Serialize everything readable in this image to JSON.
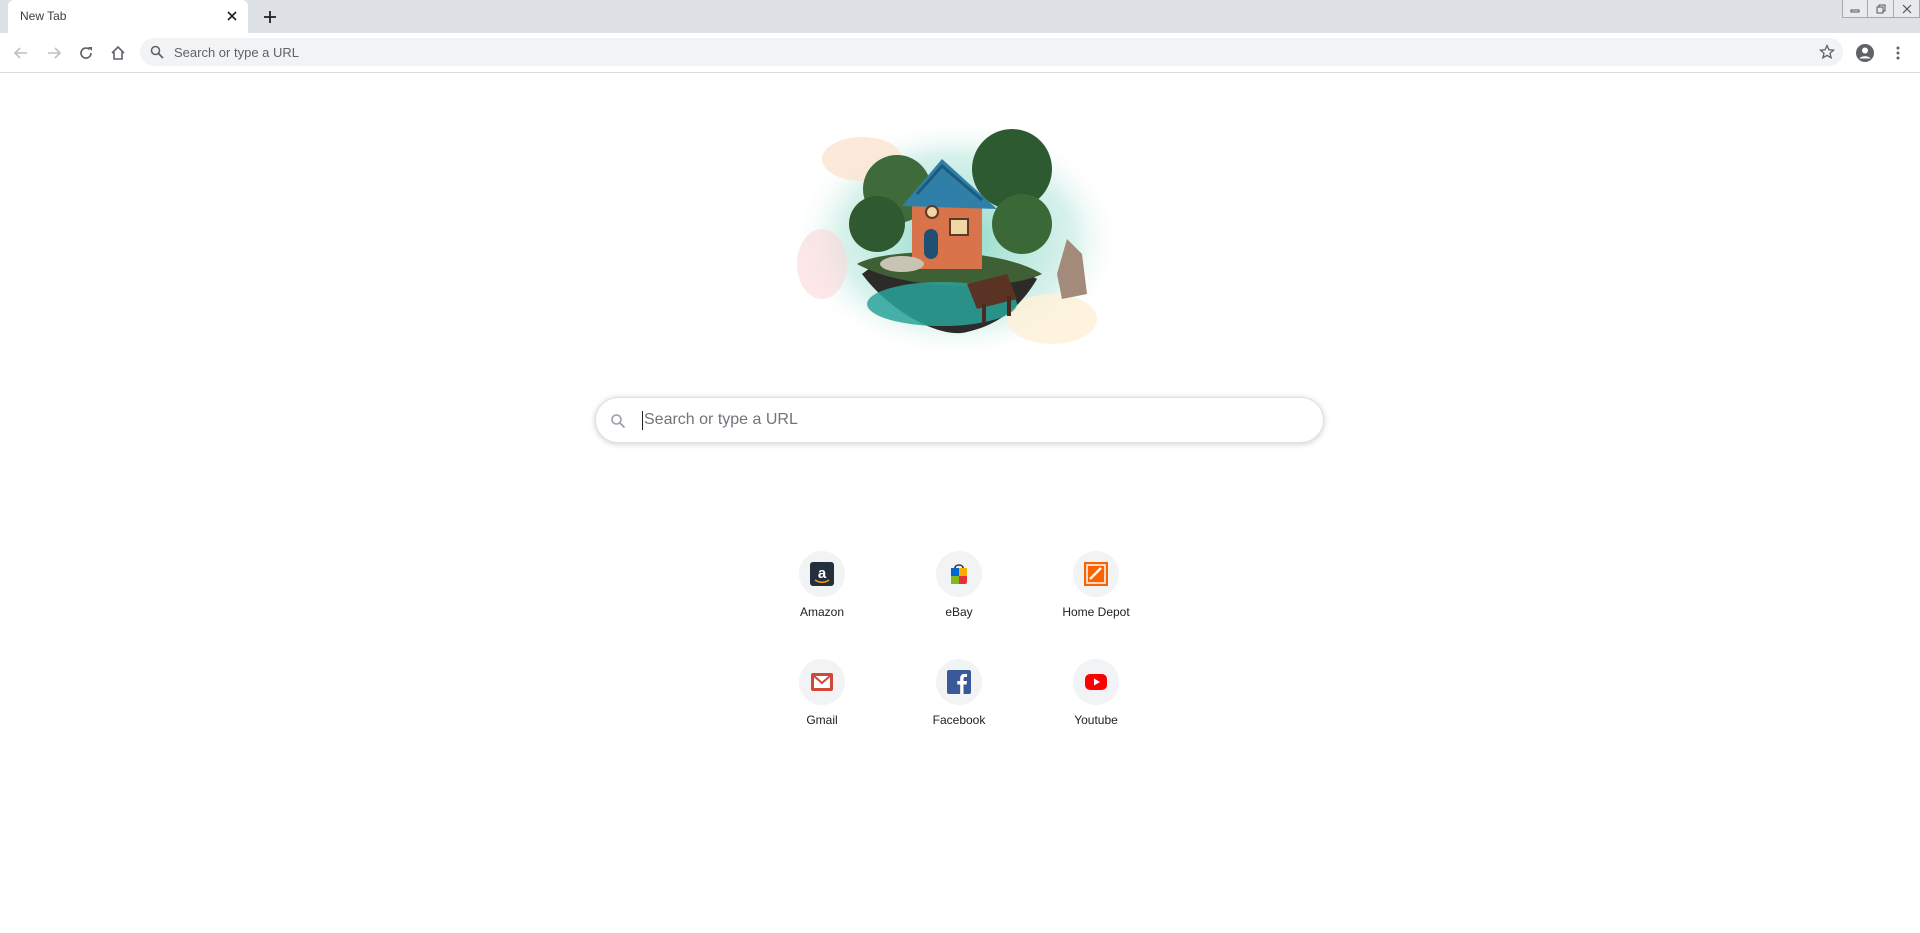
{
  "tab": {
    "title": "New Tab"
  },
  "omnibox": {
    "placeholder": "Search or type a URL"
  },
  "realbox": {
    "placeholder": "Search or type a URL"
  },
  "shortcuts": [
    {
      "label": "Amazon",
      "icon": "amazon-logo"
    },
    {
      "label": "eBay",
      "icon": "ebay-bag"
    },
    {
      "label": "Home Depot",
      "icon": "home-depot-logo"
    },
    {
      "label": "Gmail",
      "icon": "gmail-envelope"
    },
    {
      "label": "Facebook",
      "icon": "facebook-logo"
    },
    {
      "label": "Youtube",
      "icon": "youtube-play"
    }
  ],
  "colors": {
    "tabstrip": "#dee1e6",
    "omnibox_bg": "#f1f3f4",
    "youtube_red": "#ff0000",
    "facebook_blue": "#3b5998",
    "home_depot_orange": "#f96302"
  }
}
